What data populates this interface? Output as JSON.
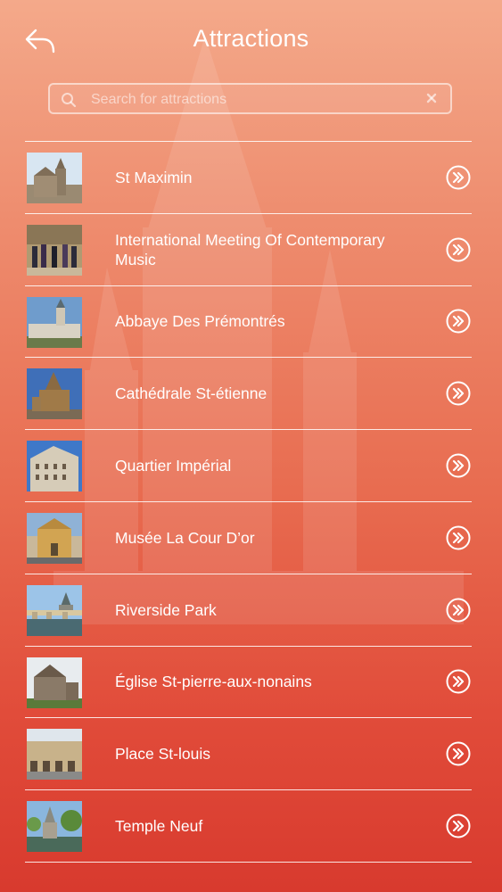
{
  "header": {
    "title": "Attractions",
    "back_icon": "back-arrow-icon"
  },
  "search": {
    "placeholder": "Search for attractions",
    "value": "",
    "search_icon": "search-icon",
    "clear_icon": "clear-icon"
  },
  "attractions": [
    {
      "name": "St Maximin"
    },
    {
      "name": "International Meeting Of Contemporary Music"
    },
    {
      "name": "Abbaye Des Prémontrés"
    },
    {
      "name": "Cathédrale St-étienne"
    },
    {
      "name": "Quartier Impérial"
    },
    {
      "name": "Musée La Cour D’or"
    },
    {
      "name": "Riverside Park"
    },
    {
      "name": "Église St-pierre-aux-nonains"
    },
    {
      "name": "Place St-louis"
    },
    {
      "name": "Temple Neuf"
    }
  ],
  "row_action_icon": "double-chevron-right-icon",
  "colors": {
    "gradient_top": "#f4a98a",
    "gradient_bottom": "#d83a2e",
    "foreground": "#ffffff"
  }
}
